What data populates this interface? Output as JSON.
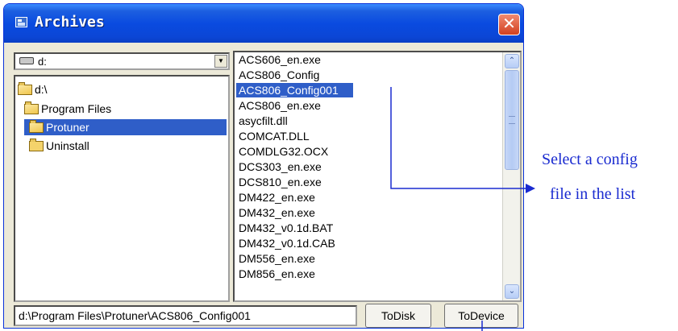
{
  "window": {
    "title": "Archives",
    "close_glyph": "✕"
  },
  "drive_selector": {
    "value": "d:",
    "dropdown_glyph": "▼"
  },
  "folder_tree": {
    "items": [
      {
        "label": "d:\\",
        "open": true
      },
      {
        "label": "Program Files",
        "open": true
      },
      {
        "label": "Protuner",
        "open": true,
        "selected": true
      },
      {
        "label": "Uninstall",
        "open": false
      }
    ]
  },
  "file_list": {
    "items": [
      "ACS606_en.exe",
      "ACS806_Config",
      "ACS806_Config001",
      "ACS806_en.exe",
      "asycfilt.dll",
      "COMCAT.DLL",
      "COMDLG32.OCX",
      "DCS303_en.exe",
      "DCS810_en.exe",
      "DM422_en.exe",
      "DM432_en.exe",
      "DM432_v0.1d.BAT",
      "DM432_v0.1d.CAB",
      "DM556_en.exe",
      "DM856_en.exe"
    ],
    "selected_index": 2,
    "scroll_up_glyph": "⌃",
    "scroll_down_glyph": "⌄"
  },
  "path_field": {
    "value": "d:\\Program Files\\Protuner\\ACS806_Config001"
  },
  "buttons": {
    "to_disk": "ToDisk",
    "to_device": "ToDevice"
  },
  "annotation": {
    "line1": "Select a config",
    "line2": "file in the list"
  },
  "colors": {
    "titlebar": "#0a4be0",
    "selection": "#2f5ec8",
    "annotation": "#1a2bd0",
    "close": "#d2401f"
  }
}
